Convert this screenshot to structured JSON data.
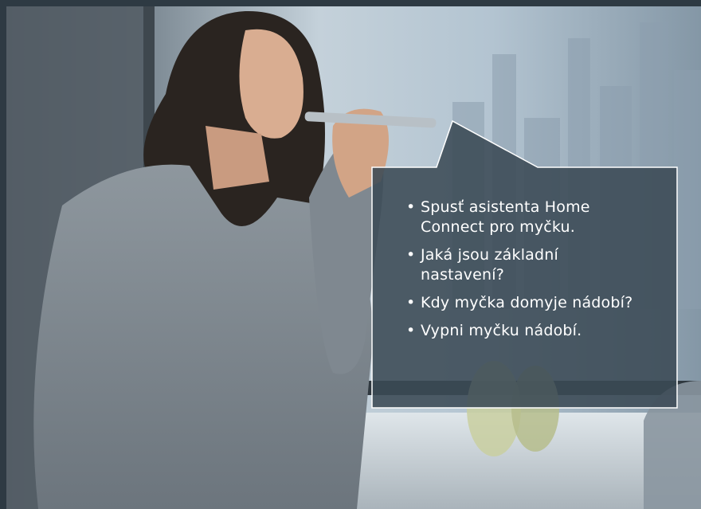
{
  "speech_bubble": {
    "bullet_glyph": "•",
    "items": [
      "Spusť asistenta Home Connect pro myčku.",
      "Jaká jsou základní nastavení?",
      "Kdy myčka domyje nádobí?",
      "Vypni myčku nádobí."
    ]
  },
  "colors": {
    "frame_background": "#2e3a43",
    "bubble_fill": "#3b4a55",
    "bubble_border": "#ffffff",
    "text": "#ffffff"
  }
}
